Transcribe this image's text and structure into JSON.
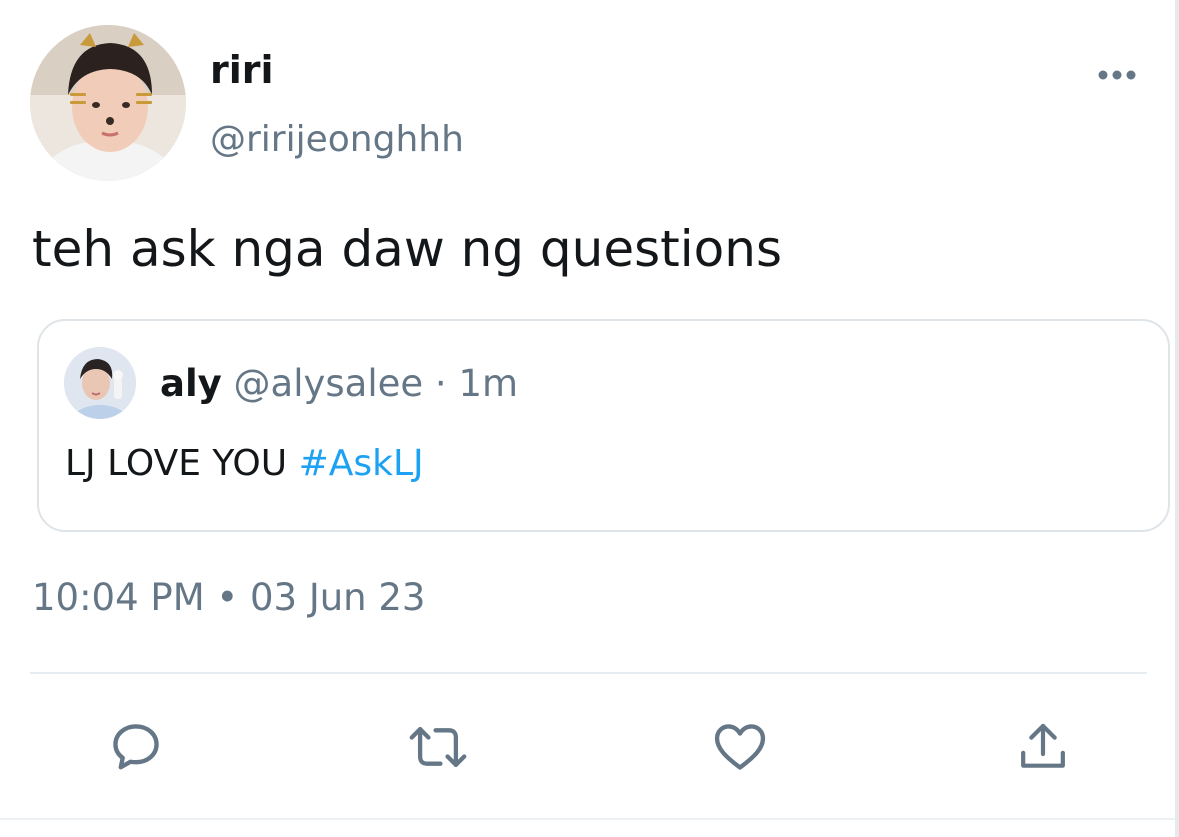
{
  "tweet": {
    "author": {
      "display_name": "riri",
      "handle": "@ririjeonghhh"
    },
    "text": "teh ask nga daw ng questions",
    "quoted": {
      "display_name": "aly",
      "meta": "@alysalee · 1m",
      "text": "LJ LOVE YOU",
      "hashtag": "#AskLJ"
    },
    "timestamp": "10:04 PM  •  03 Jun 23"
  },
  "icons": {
    "more": "more-horizontal-icon",
    "reply": "reply-icon",
    "retweet": "retweet-icon",
    "like": "heart-icon",
    "share": "share-icon"
  },
  "colors": {
    "text": "#14171a",
    "secondary": "#657786",
    "link": "#1da1f2",
    "border": "#dfe4e8"
  }
}
